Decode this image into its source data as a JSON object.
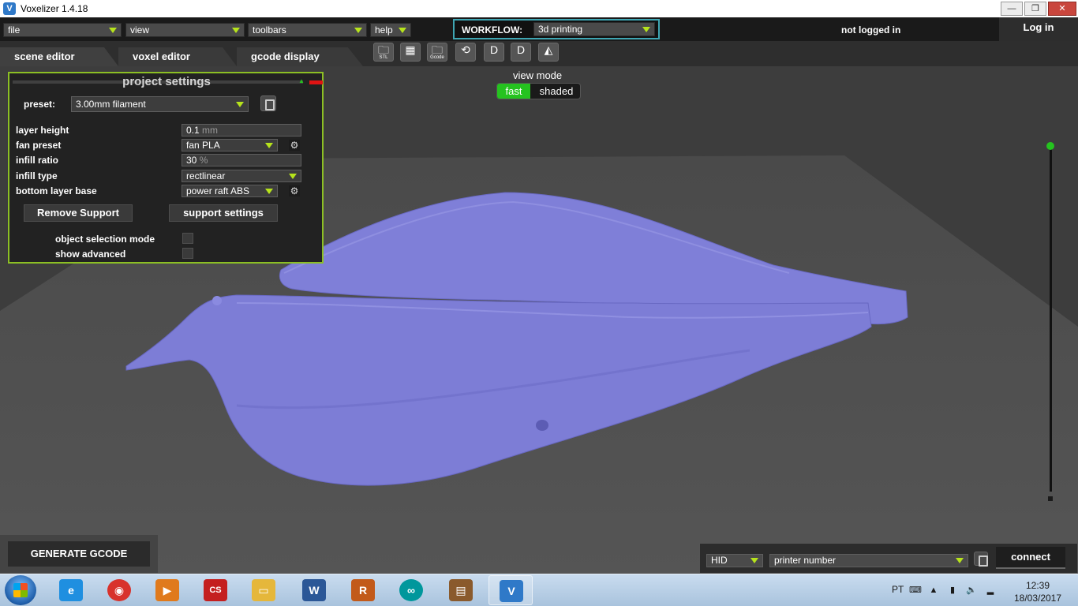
{
  "window": {
    "title": "Voxelizer 1.4.18",
    "app_icon": "V",
    "min": "—",
    "max": "❐",
    "close": "✕"
  },
  "menubar": {
    "menus": [
      "file",
      "view",
      "toolbars",
      "help"
    ],
    "workflow_label": "WORKFLOW:",
    "workflow_value": "3d printing",
    "login_status": "not logged in",
    "login_button": "Log in"
  },
  "tabs": [
    "scene editor",
    "voxel editor",
    "gcode display"
  ],
  "toolbar": {
    "icons": [
      {
        "name": "open-stl-icon",
        "glyph": "🗀",
        "caption": "STL"
      },
      {
        "name": "checker-icon",
        "glyph": "▦",
        "caption": ""
      },
      {
        "name": "open-gcode-icon",
        "glyph": "🗀",
        "caption": "Gcode"
      },
      {
        "name": "rotate-icon",
        "glyph": "⟲",
        "caption": ""
      },
      {
        "name": "d-arrow-down-icon",
        "glyph": "D",
        "caption": ""
      },
      {
        "name": "d-arrow-up-icon",
        "glyph": "D",
        "caption": ""
      },
      {
        "name": "ultimaker-icon",
        "glyph": "◭",
        "caption": ""
      }
    ]
  },
  "view_mode": {
    "label": "view mode",
    "fast": "fast",
    "shaded": "shaded",
    "active": "fast"
  },
  "project_settings": {
    "title": "project settings",
    "preset_label": "preset:",
    "preset_value": "3.00mm filament",
    "rows": {
      "layer_height": {
        "label": "layer height",
        "value": "0.1",
        "unit": "mm"
      },
      "fan_preset": {
        "label": "fan preset",
        "value": "fan PLA"
      },
      "infill_ratio": {
        "label": "infill ratio",
        "value": "30",
        "unit": "%"
      },
      "infill_type": {
        "label": "infill type",
        "value": "rectlinear"
      },
      "bottom_layer_base": {
        "label": "bottom layer base",
        "value": "power raft ABS"
      }
    },
    "remove_support": "Remove Support",
    "support_settings": "support settings",
    "object_selection_mode": "object selection mode",
    "show_advanced": "show advanced"
  },
  "bottom": {
    "generate_gcode": "GENERATE GCODE",
    "connection_type": "HID",
    "printer_number": "printer number",
    "connect": "connect"
  },
  "taskbar": {
    "apps": [
      {
        "name": "internet-explorer-icon",
        "glyph": "e",
        "color": "#1f8fe0"
      },
      {
        "name": "chrome-icon",
        "glyph": "◉",
        "color": "#d8322c"
      },
      {
        "name": "media-player-icon",
        "glyph": "▶",
        "color": "#e07a1c"
      },
      {
        "name": "eagle-icon",
        "glyph": "CS",
        "color": "#c41f1f"
      },
      {
        "name": "file-explorer-icon",
        "glyph": "▭",
        "color": "#e5b73b"
      },
      {
        "name": "word-icon",
        "glyph": "W",
        "color": "#2b5797"
      },
      {
        "name": "r-app-icon",
        "glyph": "R",
        "color": "#c25a1a"
      },
      {
        "name": "arduino-icon",
        "glyph": "∞",
        "color": "#00979c"
      },
      {
        "name": "copper-cam-icon",
        "glyph": "▤",
        "color": "#8a5a2c"
      },
      {
        "name": "voxelizer-taskbar-icon",
        "glyph": "V",
        "color": "#2f79c8"
      }
    ],
    "language": "PT",
    "time": "12:39",
    "date": "18/03/2017"
  }
}
